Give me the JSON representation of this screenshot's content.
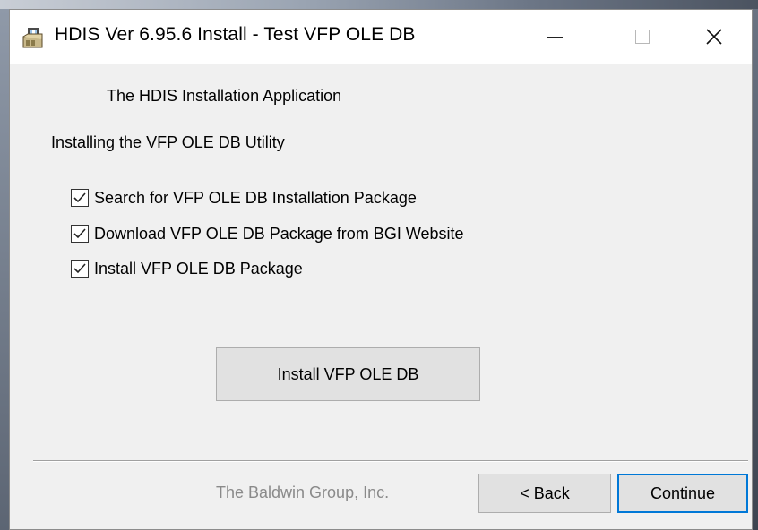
{
  "window": {
    "title": "HDIS Ver 6.95.6 Install - Test VFP OLE DB",
    "icon": "installer-package-icon",
    "controls": {
      "minimize": "—",
      "maximize": "☐",
      "close": "✕"
    }
  },
  "main": {
    "heading": "The HDIS Installation Application",
    "subheading": "Installing the VFP OLE DB Utility",
    "steps": [
      {
        "label": "Search for VFP OLE DB Installation Package",
        "checked": true
      },
      {
        "label": "Download VFP OLE DB Package from BGI Website",
        "checked": true
      },
      {
        "label": "Install VFP OLE DB Package",
        "checked": true
      }
    ],
    "action_button": "Install VFP OLE DB"
  },
  "footer": {
    "company": "The Baldwin Group, Inc.",
    "back_button": "< Back",
    "continue_button": "Continue"
  },
  "colors": {
    "accent": "#0078d7",
    "dialog_bg": "#f0f0f0",
    "button_bg": "#e1e1e1",
    "disabled_text": "#8a8a8a"
  }
}
